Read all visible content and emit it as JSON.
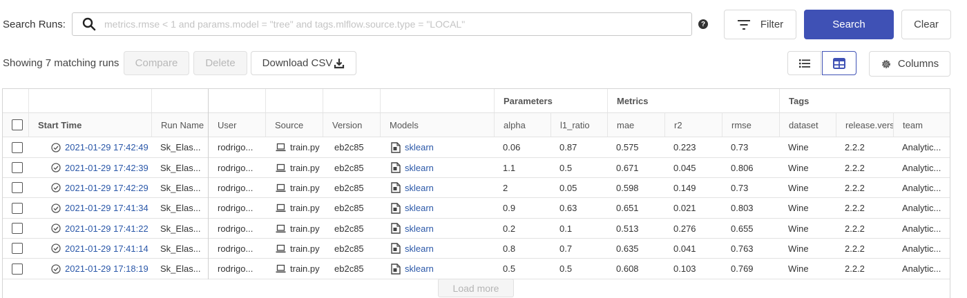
{
  "search": {
    "label": "Search Runs:",
    "placeholder": "metrics.rmse < 1 and params.model = \"tree\" and tags.mlflow.source.type = \"LOCAL\"",
    "help": "?",
    "filter_label": "Filter",
    "search_label": "Search",
    "clear_label": "Clear"
  },
  "toolbar": {
    "showing_text": "Showing 7 matching runs",
    "compare_label": "Compare",
    "delete_label": "Delete",
    "download_label": "Download CSV",
    "columns_label": "Columns"
  },
  "table": {
    "groups": {
      "parameters": "Parameters",
      "metrics": "Metrics",
      "tags": "Tags"
    },
    "headers": {
      "start_time": "Start Time",
      "run_name": "Run Name",
      "user": "User",
      "source": "Source",
      "version": "Version",
      "models": "Models",
      "alpha": "alpha",
      "l1_ratio": "l1_ratio",
      "mae": "mae",
      "r2": "r2",
      "rmse": "rmse",
      "dataset": "dataset",
      "release": "release.vers",
      "team": "team"
    },
    "rows": [
      {
        "start_time": "2021-01-29 17:42:49",
        "run_name": "Sk_Elas...",
        "user": "rodrigo...",
        "source": "train.py",
        "version": "eb2c85",
        "model": "sklearn",
        "alpha": "0.06",
        "l1_ratio": "0.87",
        "mae": "0.575",
        "r2": "0.223",
        "rmse": "0.73",
        "dataset": "Wine",
        "release": "2.2.2",
        "team": "Analytic..."
      },
      {
        "start_time": "2021-01-29 17:42:39",
        "run_name": "Sk_Elas...",
        "user": "rodrigo...",
        "source": "train.py",
        "version": "eb2c85",
        "model": "sklearn",
        "alpha": "1.1",
        "l1_ratio": "0.5",
        "mae": "0.671",
        "r2": "0.045",
        "rmse": "0.806",
        "dataset": "Wine",
        "release": "2.2.2",
        "team": "Analytic..."
      },
      {
        "start_time": "2021-01-29 17:42:29",
        "run_name": "Sk_Elas...",
        "user": "rodrigo...",
        "source": "train.py",
        "version": "eb2c85",
        "model": "sklearn",
        "alpha": "2",
        "l1_ratio": "0.05",
        "mae": "0.598",
        "r2": "0.149",
        "rmse": "0.73",
        "dataset": "Wine",
        "release": "2.2.2",
        "team": "Analytic..."
      },
      {
        "start_time": "2021-01-29 17:41:34",
        "run_name": "Sk_Elas...",
        "user": "rodrigo...",
        "source": "train.py",
        "version": "eb2c85",
        "model": "sklearn",
        "alpha": "0.9",
        "l1_ratio": "0.63",
        "mae": "0.651",
        "r2": "0.021",
        "rmse": "0.803",
        "dataset": "Wine",
        "release": "2.2.2",
        "team": "Analytic..."
      },
      {
        "start_time": "2021-01-29 17:41:22",
        "run_name": "Sk_Elas...",
        "user": "rodrigo...",
        "source": "train.py",
        "version": "eb2c85",
        "model": "sklearn",
        "alpha": "0.2",
        "l1_ratio": "0.1",
        "mae": "0.513",
        "r2": "0.276",
        "rmse": "0.655",
        "dataset": "Wine",
        "release": "2.2.2",
        "team": "Analytic..."
      },
      {
        "start_time": "2021-01-29 17:41:14",
        "run_name": "Sk_Elas...",
        "user": "rodrigo...",
        "source": "train.py",
        "version": "eb2c85",
        "model": "sklearn",
        "alpha": "0.8",
        "l1_ratio": "0.7",
        "mae": "0.635",
        "r2": "0.041",
        "rmse": "0.763",
        "dataset": "Wine",
        "release": "2.2.2",
        "team": "Analytic..."
      },
      {
        "start_time": "2021-01-29 17:18:19",
        "run_name": "Sk_Elas...",
        "user": "rodrigo...",
        "source": "train.py",
        "version": "eb2c85",
        "model": "sklearn",
        "alpha": "0.5",
        "l1_ratio": "0.5",
        "mae": "0.608",
        "r2": "0.103",
        "rmse": "0.769",
        "dataset": "Wine",
        "release": "2.2.2",
        "team": "Analytic..."
      }
    ],
    "load_more_label": "Load more"
  },
  "icons": {
    "search": "magnifier-icon",
    "help": "question-circle-icon",
    "filter": "filter-lines-icon",
    "download": "download-icon",
    "list_view": "list-view-icon",
    "table_view": "table-view-icon",
    "columns": "gear-icon",
    "status": "check-circle-icon",
    "source": "laptop-icon",
    "model": "model-file-icon"
  },
  "colors": {
    "primary": "#3f51b5",
    "link": "#2a57a8"
  }
}
